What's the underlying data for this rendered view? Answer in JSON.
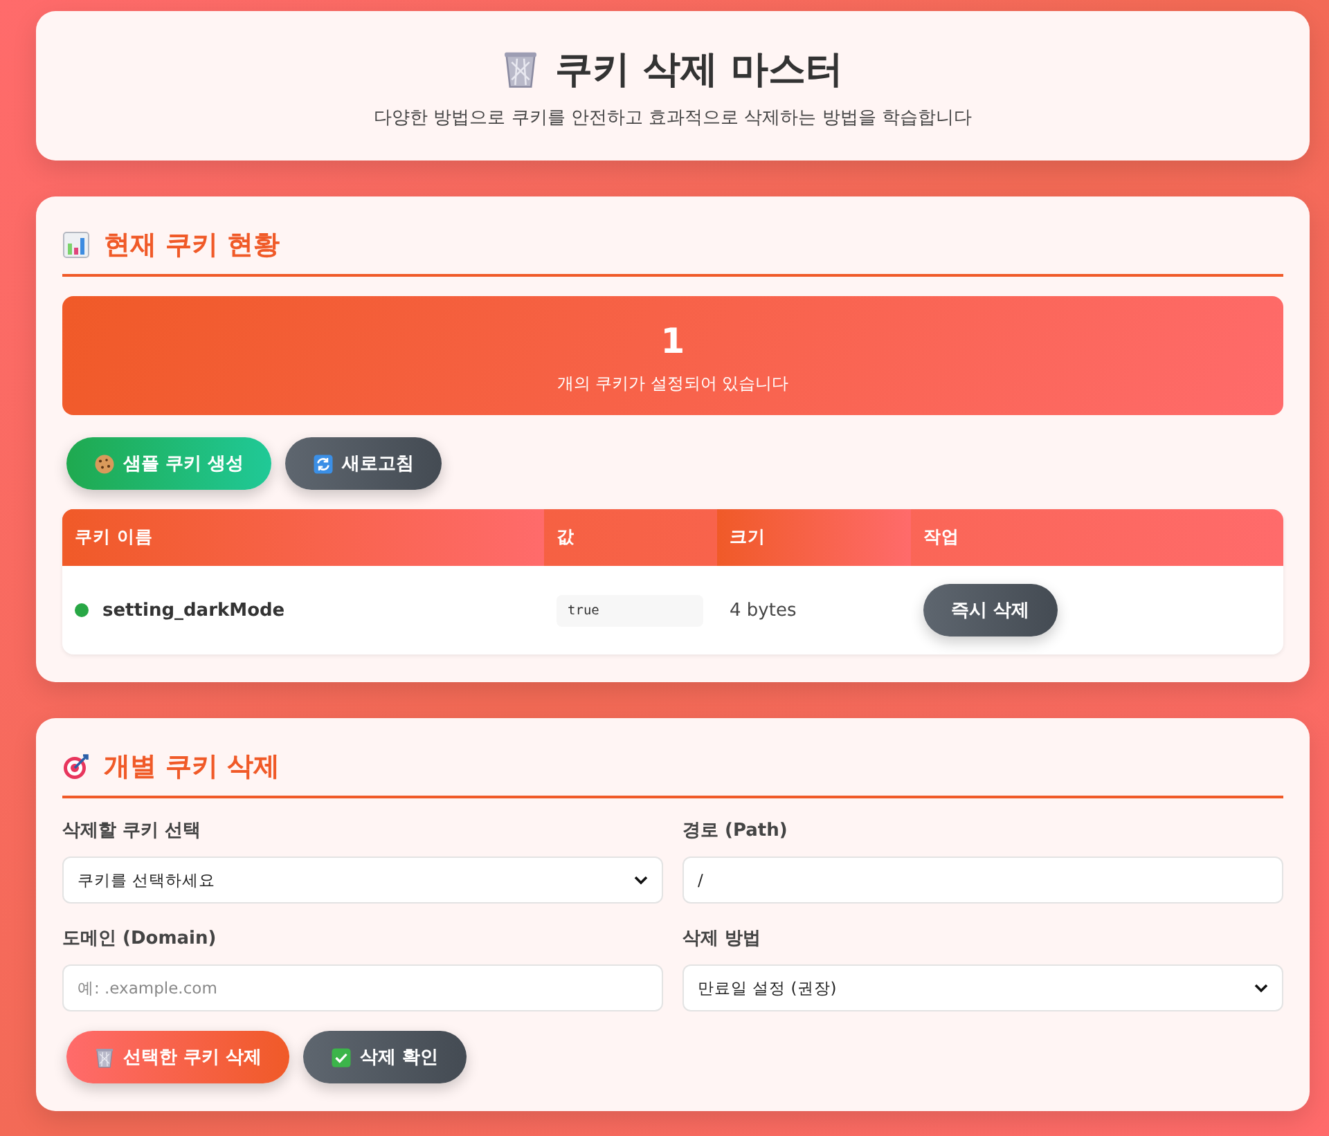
{
  "header": {
    "title": "쿠키 삭제 마스터",
    "subtitle": "다양한 방법으로 쿠키를 안전하고 효과적으로 삭제하는 방법을 학습합니다"
  },
  "status": {
    "title": "현재 쿠키 현황",
    "count": "1",
    "caption": "개의 쿠키가 설정되어 있습니다",
    "buttons": [
      {
        "label": "샘플 쿠키 생성",
        "kind": "success"
      },
      {
        "label": "새로고침",
        "kind": "secondary"
      }
    ]
  },
  "table": {
    "columns": [
      "쿠키 이름",
      "값",
      "크기",
      "작업"
    ],
    "rows": [
      {
        "name": "setting_darkMode",
        "color": "#28a745",
        "value": "true",
        "size": "4 bytes",
        "action": "즉시 삭제"
      }
    ]
  },
  "individual": {
    "title": "개별 쿠키 삭제",
    "fields": [
      {
        "label": "삭제할 쿠키 선택",
        "kind": "select",
        "value": "쿠키를 선택하세요"
      },
      {
        "label": "경로 (Path)",
        "kind": "input",
        "value": "/"
      },
      {
        "label": "도메인 (Domain)",
        "kind": "input",
        "placeholder": "예: .example.com"
      },
      {
        "label": "삭제 방법",
        "kind": "select",
        "value": "만료일 설정 (권장)"
      }
    ],
    "buttons": [
      {
        "label": "선택한 쿠키 삭제",
        "kind": "danger"
      },
      {
        "label": "삭제 확인",
        "kind": "secondary"
      }
    ]
  }
}
